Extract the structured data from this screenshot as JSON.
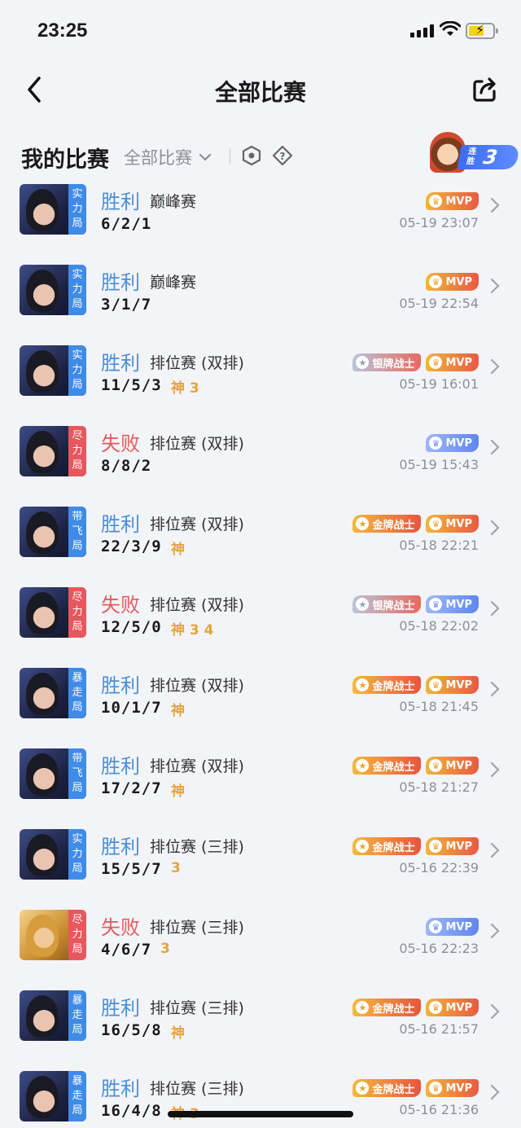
{
  "status_bar": {
    "time": "23:25"
  },
  "nav": {
    "title": "全部比赛"
  },
  "section": {
    "title": "我的比赛",
    "filter": "全部比赛",
    "streak_label": "连胜",
    "streak_count": "3"
  },
  "matches": [
    {
      "result": "胜利",
      "outcome": "win",
      "mode": "巅峰赛",
      "kda": "6/2/1",
      "extras": "",
      "tag": "实力局",
      "tag_color": "blue",
      "badges": [
        {
          "type": "mvp-gold",
          "label": "MVP"
        }
      ],
      "time": "05-19 23:07",
      "avatar": "dark"
    },
    {
      "result": "胜利",
      "outcome": "win",
      "mode": "巅峰赛",
      "kda": "3/1/7",
      "extras": "",
      "tag": "实力局",
      "tag_color": "blue",
      "badges": [
        {
          "type": "mvp-gold",
          "label": "MVP"
        }
      ],
      "time": "05-19 22:54",
      "avatar": "dark"
    },
    {
      "result": "胜利",
      "outcome": "win",
      "mode": "排位赛 (双排)",
      "kda": "11/5/3",
      "extras": "神 3",
      "tag": "实力局",
      "tag_color": "blue",
      "badges": [
        {
          "type": "silver-warrior",
          "label": "银牌战士"
        },
        {
          "type": "mvp-gold",
          "label": "MVP"
        }
      ],
      "time": "05-19 16:01",
      "avatar": "dark"
    },
    {
      "result": "失败",
      "outcome": "lose",
      "mode": "排位赛 (双排)",
      "kda": "8/8/2",
      "extras": "",
      "tag": "尽力局",
      "tag_color": "red",
      "badges": [
        {
          "type": "mvp-blue",
          "label": "MVP"
        }
      ],
      "time": "05-19 15:43",
      "avatar": "dark"
    },
    {
      "result": "胜利",
      "outcome": "win",
      "mode": "排位赛 (双排)",
      "kda": "22/3/9",
      "extras": "神",
      "tag": "带飞局",
      "tag_color": "blue",
      "badges": [
        {
          "type": "gold-warrior",
          "label": "金牌战士"
        },
        {
          "type": "mvp-gold",
          "label": "MVP"
        }
      ],
      "time": "05-18 22:21",
      "avatar": "dark"
    },
    {
      "result": "失败",
      "outcome": "lose",
      "mode": "排位赛 (双排)",
      "kda": "12/5/0",
      "extras": "神 3 4",
      "tag": "尽力局",
      "tag_color": "red",
      "badges": [
        {
          "type": "silver-warrior",
          "label": "银牌战士"
        },
        {
          "type": "mvp-blue",
          "label": "MVP"
        }
      ],
      "time": "05-18 22:02",
      "avatar": "dark"
    },
    {
      "result": "胜利",
      "outcome": "win",
      "mode": "排位赛 (双排)",
      "kda": "10/1/7",
      "extras": "神",
      "tag": "暴走局",
      "tag_color": "blue",
      "badges": [
        {
          "type": "gold-warrior",
          "label": "金牌战士"
        },
        {
          "type": "mvp-gold",
          "label": "MVP"
        }
      ],
      "time": "05-18 21:45",
      "avatar": "dark"
    },
    {
      "result": "胜利",
      "outcome": "win",
      "mode": "排位赛 (双排)",
      "kda": "17/2/7",
      "extras": "神",
      "tag": "带飞局",
      "tag_color": "blue",
      "badges": [
        {
          "type": "gold-warrior",
          "label": "金牌战士"
        },
        {
          "type": "mvp-gold",
          "label": "MVP"
        }
      ],
      "time": "05-18 21:27",
      "avatar": "dark"
    },
    {
      "result": "胜利",
      "outcome": "win",
      "mode": "排位赛 (三排)",
      "kda": "15/5/7",
      "extras": "3",
      "tag": "实力局",
      "tag_color": "blue",
      "badges": [
        {
          "type": "gold-warrior",
          "label": "金牌战士"
        },
        {
          "type": "mvp-gold",
          "label": "MVP"
        }
      ],
      "time": "05-16 22:39",
      "avatar": "dark"
    },
    {
      "result": "失败",
      "outcome": "lose",
      "mode": "排位赛 (三排)",
      "kda": "4/6/7",
      "extras": "3",
      "tag": "尽力局",
      "tag_color": "red",
      "badges": [
        {
          "type": "mvp-blue",
          "label": "MVP"
        }
      ],
      "time": "05-16 22:23",
      "avatar": "gold"
    },
    {
      "result": "胜利",
      "outcome": "win",
      "mode": "排位赛 (三排)",
      "kda": "16/5/8",
      "extras": "神",
      "tag": "暴走局",
      "tag_color": "blue",
      "badges": [
        {
          "type": "gold-warrior",
          "label": "金牌战士"
        },
        {
          "type": "mvp-gold",
          "label": "MVP"
        }
      ],
      "time": "05-16 21:57",
      "avatar": "dark"
    },
    {
      "result": "胜利",
      "outcome": "win",
      "mode": "排位赛 (三排)",
      "kda": "16/4/8",
      "extras": "神 3",
      "tag": "暴走局",
      "tag_color": "blue",
      "badges": [
        {
          "type": "gold-warrior",
          "label": "金牌战士"
        },
        {
          "type": "mvp-gold",
          "label": "MVP"
        }
      ],
      "time": "05-16 21:36",
      "avatar": "dark"
    }
  ],
  "icons": {
    "back": "chevron-left-icon",
    "share": "share-icon",
    "filter_caret": "chevron-down-icon",
    "hex": "hexagon-icon",
    "help": "help-icon",
    "row_chevron": "chevron-right-icon"
  },
  "colors": {
    "win": "#4a90d9",
    "lose": "#e25c5c",
    "background": "#f3f4f8",
    "accent_gold": "#e7a33a"
  }
}
